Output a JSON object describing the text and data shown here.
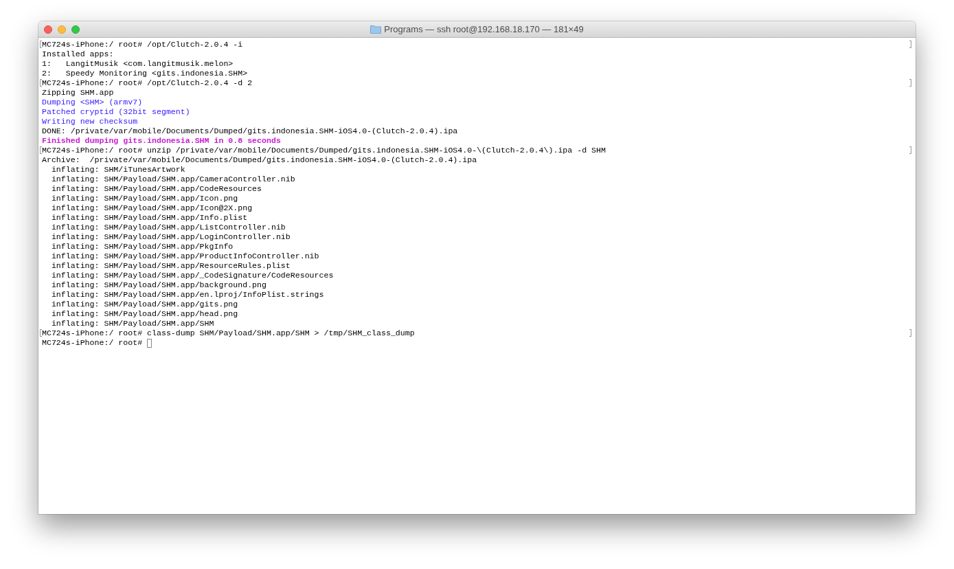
{
  "window": {
    "title": "Programs — ssh root@192.168.18.170 — 181×49"
  },
  "terminal": {
    "lines": [
      {
        "text": "MC724s-iPhone:/ root# /opt/Clutch-2.0.4 -i",
        "kind": "plain",
        "marked": true
      },
      {
        "text": "Installed apps:",
        "kind": "plain",
        "marked": false
      },
      {
        "text": "1:   LangitMusik <com.langitmusik.melon>",
        "kind": "plain",
        "marked": false
      },
      {
        "text": "2:   Speedy Monitoring <gits.indonesia.SHM>",
        "kind": "plain",
        "marked": false
      },
      {
        "text": "MC724s-iPhone:/ root# /opt/Clutch-2.0.4 -d 2",
        "kind": "plain",
        "marked": true
      },
      {
        "text": "Zipping SHM.app",
        "kind": "plain",
        "marked": false
      },
      {
        "text": "Dumping <SHM> (armv7)",
        "kind": "info",
        "marked": false
      },
      {
        "text": "Patched cryptid (32bit segment)",
        "kind": "info",
        "marked": false
      },
      {
        "text": "Writing new checksum",
        "kind": "info",
        "marked": false
      },
      {
        "text": "DONE: /private/var/mobile/Documents/Dumped/gits.indonesia.SHM-iOS4.0-(Clutch-2.0.4).ipa",
        "kind": "plain",
        "marked": false
      },
      {
        "text": "Finished dumping gits.indonesia.SHM in 0.8 seconds",
        "kind": "success",
        "marked": false
      },
      {
        "text": "MC724s-iPhone:/ root# unzip /private/var/mobile/Documents/Dumped/gits.indonesia.SHM-iOS4.0-\\(Clutch-2.0.4\\).ipa -d SHM",
        "kind": "plain",
        "marked": true
      },
      {
        "text": "Archive:  /private/var/mobile/Documents/Dumped/gits.indonesia.SHM-iOS4.0-(Clutch-2.0.4).ipa",
        "kind": "plain",
        "marked": false
      },
      {
        "text": "  inflating: SHM/iTunesArtwork",
        "kind": "plain",
        "marked": false
      },
      {
        "text": "  inflating: SHM/Payload/SHM.app/CameraController.nib",
        "kind": "plain",
        "marked": false
      },
      {
        "text": "  inflating: SHM/Payload/SHM.app/CodeResources",
        "kind": "plain",
        "marked": false
      },
      {
        "text": "  inflating: SHM/Payload/SHM.app/Icon.png",
        "kind": "plain",
        "marked": false
      },
      {
        "text": "  inflating: SHM/Payload/SHM.app/Icon@2X.png",
        "kind": "plain",
        "marked": false
      },
      {
        "text": "  inflating: SHM/Payload/SHM.app/Info.plist",
        "kind": "plain",
        "marked": false
      },
      {
        "text": "  inflating: SHM/Payload/SHM.app/ListController.nib",
        "kind": "plain",
        "marked": false
      },
      {
        "text": "  inflating: SHM/Payload/SHM.app/LoginController.nib",
        "kind": "plain",
        "marked": false
      },
      {
        "text": "  inflating: SHM/Payload/SHM.app/PkgInfo",
        "kind": "plain",
        "marked": false
      },
      {
        "text": "  inflating: SHM/Payload/SHM.app/ProductInfoController.nib",
        "kind": "plain",
        "marked": false
      },
      {
        "text": "  inflating: SHM/Payload/SHM.app/ResourceRules.plist",
        "kind": "plain",
        "marked": false
      },
      {
        "text": "  inflating: SHM/Payload/SHM.app/_CodeSignature/CodeResources",
        "kind": "plain",
        "marked": false
      },
      {
        "text": "  inflating: SHM/Payload/SHM.app/background.png",
        "kind": "plain",
        "marked": false
      },
      {
        "text": "  inflating: SHM/Payload/SHM.app/en.lproj/InfoPlist.strings",
        "kind": "plain",
        "marked": false
      },
      {
        "text": "  inflating: SHM/Payload/SHM.app/gits.png",
        "kind": "plain",
        "marked": false
      },
      {
        "text": "  inflating: SHM/Payload/SHM.app/head.png",
        "kind": "plain",
        "marked": false
      },
      {
        "text": "  inflating: SHM/Payload/SHM.app/SHM",
        "kind": "plain",
        "marked": false
      },
      {
        "text": "MC724s-iPhone:/ root# class-dump SHM/Payload/SHM.app/SHM > /tmp/SHM_class_dump",
        "kind": "plain",
        "marked": true
      },
      {
        "text": "MC724s-iPhone:/ root#",
        "kind": "prompt",
        "marked": false
      }
    ]
  }
}
